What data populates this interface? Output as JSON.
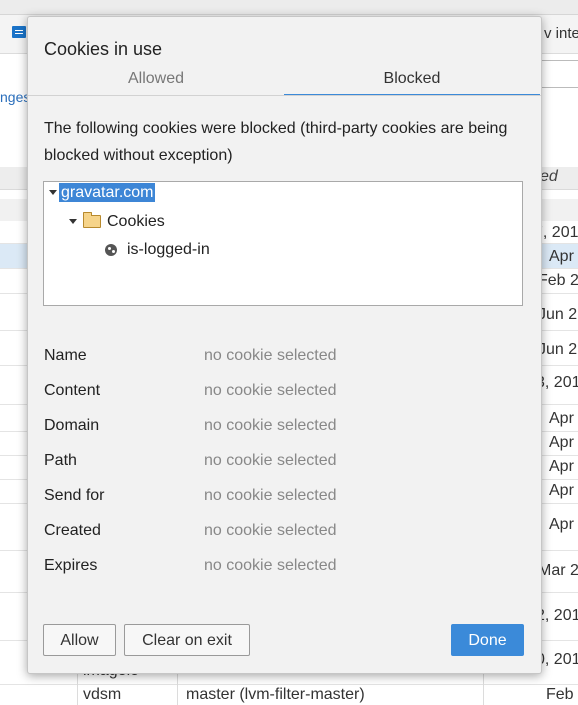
{
  "background": {
    "header_text": "v inte",
    "link_text": "nges",
    "column_header": "ed",
    "date_cells": [
      "7, 201",
      "Apr",
      "Feb 2",
      "Jun 2",
      "Jun 2",
      "3, 201",
      "Apr",
      "Apr",
      "Apr",
      "Apr",
      "Apr",
      "Mar 2",
      "2, 201",
      "0, 201",
      "Feb"
    ],
    "bottom_row": {
      "partial_name": "imageio",
      "project": "vdsm",
      "branch": "master (lvm-filter-master)"
    }
  },
  "dialog": {
    "title": "Cookies in use",
    "tabs": [
      {
        "label": "Allowed",
        "active": false
      },
      {
        "label": "Blocked",
        "active": true
      }
    ],
    "description": "The following cookies were blocked (third-party cookies are being blocked without exception)",
    "tree": {
      "root": "gravatar.com",
      "folder": "Cookies",
      "cookie": "is-logged-in"
    },
    "details": [
      {
        "label": "Name",
        "value": "no cookie selected"
      },
      {
        "label": "Content",
        "value": "no cookie selected"
      },
      {
        "label": "Domain",
        "value": "no cookie selected"
      },
      {
        "label": "Path",
        "value": "no cookie selected"
      },
      {
        "label": "Send for",
        "value": "no cookie selected"
      },
      {
        "label": "Created",
        "value": "no cookie selected"
      },
      {
        "label": "Expires",
        "value": "no cookie selected"
      }
    ],
    "buttons": {
      "allow": "Allow",
      "clear": "Clear on exit",
      "done": "Done"
    },
    "accent_color": "#3b8ad9"
  }
}
